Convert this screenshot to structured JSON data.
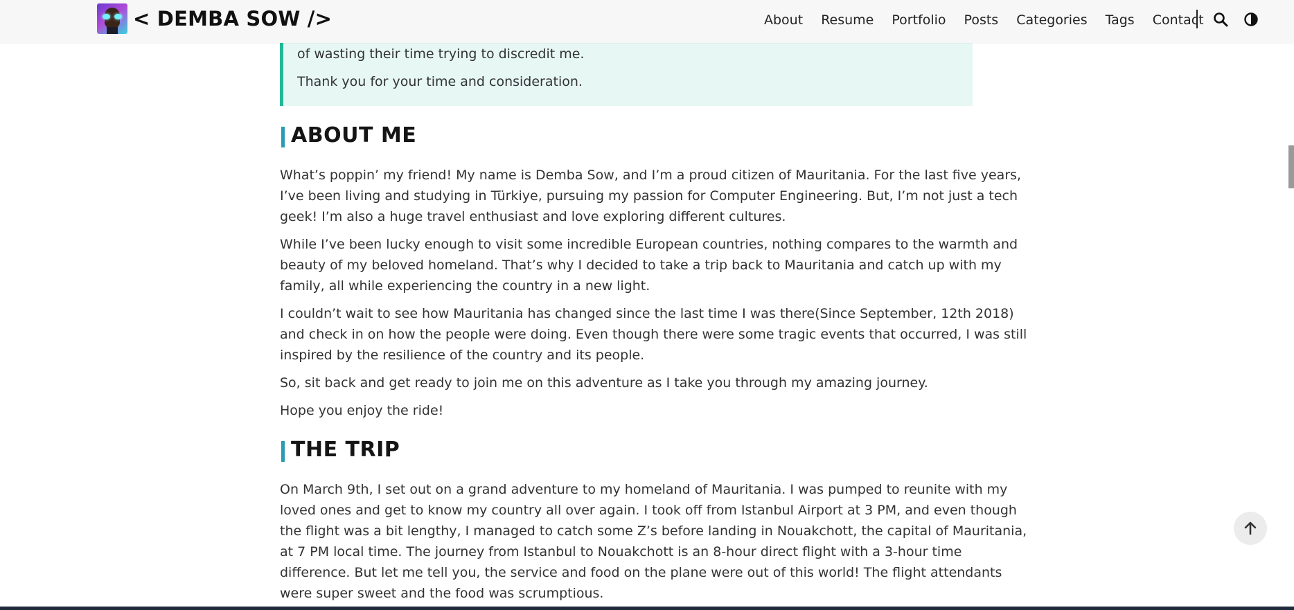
{
  "header": {
    "brand": "< DEMBA SOW />",
    "nav": [
      "About",
      "Resume",
      "Portfolio",
      "Posts",
      "Categories",
      "Tags",
      "Contact"
    ],
    "icons": [
      "search-icon",
      "theme-toggle-icon"
    ]
  },
  "quote": {
    "lines": [
      "of wasting their time trying to discredit me.",
      "Thank you for your time and consideration."
    ]
  },
  "about": {
    "heading": "ABOUT ME",
    "paragraphs": [
      [
        "What’s poppin’ my friend! My name is Demba Sow, and I’m a proud citizen of Mauritania. For the last five years,",
        "I’ve been living and studying in Türkiye, pursuing my passion for Computer Engineering. But, I’m not just a tech",
        "geek! I’m also a huge travel enthusiast and love exploring different cultures."
      ],
      [
        "While I’ve been lucky enough to visit some incredible European countries, nothing compares to the warmth and",
        "beauty of my beloved homeland. That’s why I decided to take a trip back to Mauritania and catch up with my",
        "family, all while experiencing the country in a new light."
      ],
      [
        "I couldn’t wait to see how Mauritania has changed since the last time I was there(Since September, 12th 2018)",
        "and check in on how the people were doing. Even though there were some tragic events that occurred, I was still",
        "inspired by the resilience of the country and its people."
      ],
      [
        "So, sit back and get ready to join me on this adventure as I take you through my amazing journey."
      ],
      [
        "Hope you enjoy the ride!"
      ]
    ]
  },
  "trip": {
    "heading": "THE TRIP",
    "paragraphs": [
      [
        "On March 9th, I set out on a grand adventure to my homeland of Mauritania. I was pumped to reunite with my",
        "loved ones and get to know my country all over again. I took off from Istanbul Airport at 3 PM, and even though",
        "the flight was a bit lengthy, I managed to catch some Z’s before landing in Nouakchott, the capital of Mauritania,",
        "at 7 PM local time. The journey from Istanbul to Nouakchott is an 8-hour direct flight with a 3-hour time",
        "difference. But let me tell you, the service and food on the plane were out of this world! The flight attendants",
        "were super sweet and the food was scrumptious."
      ]
    ]
  },
  "colors": {
    "quote_bg": "#e6f7f4",
    "quote_border": "#21b899",
    "heading_bar": "#2b9bb5",
    "header_bg": "#f7f7f7"
  }
}
